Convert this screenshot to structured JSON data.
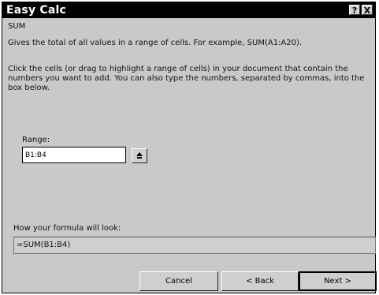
{
  "window": {
    "title": "Easy Calc",
    "help_button": "?",
    "close_button": "X"
  },
  "function": {
    "name": "SUM",
    "description": "Gives the total of all values in a range of cells. For example, SUM(A1:A20).",
    "instructions": "Click the cells (or drag to highlight a range of cells) in your document that contain the numbers you want to add. You can also type the numbers, separated by commas, into the box below."
  },
  "range": {
    "label": "Range:",
    "value": "B1:B4",
    "collapse_icon": "collapse-dialog-icon"
  },
  "formula": {
    "label": "How your formula will look:",
    "preview": "=SUM(B1:B4)"
  },
  "buttons": {
    "cancel": "Cancel",
    "back": "< Back",
    "next": "Next >"
  }
}
